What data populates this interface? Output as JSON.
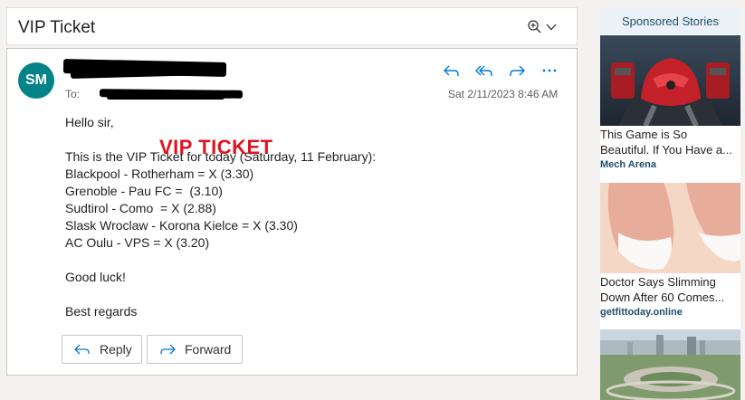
{
  "email": {
    "subject": "VIP Ticket",
    "avatar_initials": "SM",
    "to_label": "To:",
    "date": "Sat 2/11/2023 8:46 AM",
    "stamp": "VIP TICKET",
    "lines": {
      "greeting": "Hello sir,",
      "intro": "This is the VIP Ticket for today (Saturday, 11 February):",
      "m1": "Blackpool - Rotherham = X (3.30)",
      "m2": "Grenoble - Pau FC =  (3.10)",
      "m3": "Sudtirol - Como  = X (2.88)",
      "m4": "Slask Wroclaw - Korona Kielce = X (3.30)",
      "m5": "AC Oulu - VPS = X (3.20)",
      "luck": "Good luck!",
      "regards": "Best regards"
    },
    "buttons": {
      "reply": "Reply",
      "forward": "Forward"
    }
  },
  "sidebar": {
    "title": "Sponsored Stories",
    "ads": [
      {
        "title1": "This Game is So",
        "title2": "Beautiful. If You Have a...",
        "source": "Mech Arena"
      },
      {
        "title1": "Doctor Says Slimming",
        "title2": "Down After 60 Comes...",
        "source": "getfittoday.online"
      }
    ]
  },
  "colors": {
    "avatar_bg": "#038387",
    "accent_blue": "#0078d4",
    "stamp_red": "#e0141e",
    "sponsor_text": "#1f4e6b"
  }
}
